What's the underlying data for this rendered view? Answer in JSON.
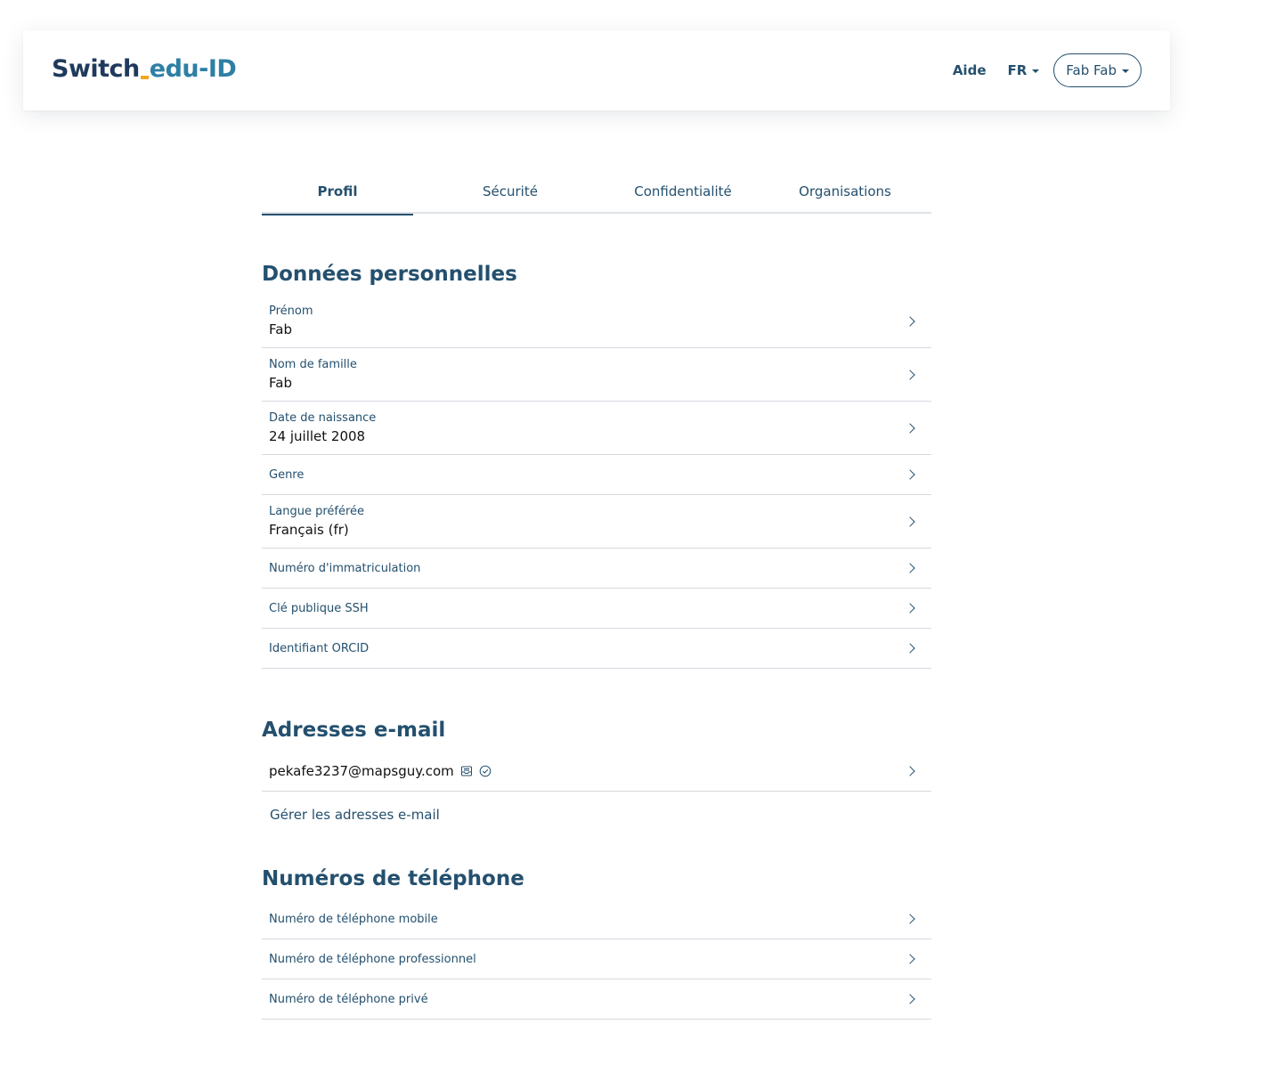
{
  "header": {
    "logo_part1": "Switch",
    "logo_part2": "edu-ID",
    "help_label": "Aide",
    "language_label": "FR",
    "user_label": "Fab Fab"
  },
  "tabs": [
    {
      "label": "Profil",
      "active": true
    },
    {
      "label": "Sécurité",
      "active": false
    },
    {
      "label": "Confidentialité",
      "active": false
    },
    {
      "label": "Organisations",
      "active": false
    }
  ],
  "personal": {
    "title": "Données personnelles",
    "rows": [
      {
        "label": "Prénom",
        "value": "Fab"
      },
      {
        "label": "Nom de famille",
        "value": "Fab"
      },
      {
        "label": "Date de naissance",
        "value": "24 juillet 2008"
      },
      {
        "label": "Genre",
        "value": ""
      },
      {
        "label": "Langue préférée",
        "value": "Français (fr)"
      },
      {
        "label": "Numéro d'immatriculation",
        "value": ""
      },
      {
        "label": "Clé publique SSH",
        "value": ""
      },
      {
        "label": "Identifiant ORCID",
        "value": ""
      }
    ]
  },
  "email": {
    "title": "Adresses e-mail",
    "address": "pekafe3237@mapsguy.com",
    "icons": [
      "inbox-icon",
      "check-circle-icon"
    ],
    "manage_label": "Gérer les adresses e-mail"
  },
  "phone": {
    "title": "Numéros de téléphone",
    "rows": [
      {
        "label": "Numéro de téléphone mobile"
      },
      {
        "label": "Numéro de téléphone professionnel"
      },
      {
        "label": "Numéro de téléphone privé"
      }
    ]
  },
  "colors": {
    "primary": "#24506e",
    "logo_dark": "#1f3a5c",
    "logo_light": "#2e7fa5",
    "logo_accent": "#f2a81d",
    "divider": "#d5dadf"
  }
}
